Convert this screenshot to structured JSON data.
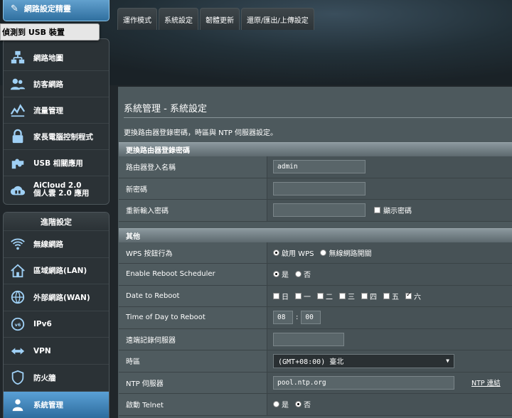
{
  "sidebar": {
    "quick_setup": "網路設定精靈",
    "usb_tip": "偵測到 USB 裝置",
    "general_items": [
      {
        "icon": "network-map-icon",
        "label": "網路地圖"
      },
      {
        "icon": "guest-network-icon",
        "label": "訪客網路"
      },
      {
        "icon": "traffic-manager-icon",
        "label": "流量管理"
      },
      {
        "icon": "parental-control-icon",
        "label": "家長電腦控制程式"
      },
      {
        "icon": "usb-application-icon",
        "label": "USB 相關應用"
      },
      {
        "icon": "aicloud-icon",
        "label": "AiCloud 2.0\n個人雲 2.0 應用"
      }
    ],
    "advanced_title": "進階設定",
    "advanced_items": [
      {
        "icon": "wireless-icon",
        "label": "無線網路"
      },
      {
        "icon": "lan-icon",
        "label": "區域網路(LAN)"
      },
      {
        "icon": "wan-icon",
        "label": "外部網路(WAN)"
      },
      {
        "icon": "ipv6-icon",
        "label": "IPv6"
      },
      {
        "icon": "vpn-icon",
        "label": "VPN"
      },
      {
        "icon": "firewall-icon",
        "label": "防火牆"
      },
      {
        "icon": "administration-icon",
        "label": "系統管理"
      }
    ]
  },
  "tabs": [
    "運作模式",
    "系統設定",
    "韌體更新",
    "還原/匯出/上傳設定"
  ],
  "page": {
    "title": "系統管理 - 系統設定",
    "description": "更換路由器登錄密碼，時區與 NTP 伺服器設定。"
  },
  "section1": {
    "header": "更換路由器登錄密碼",
    "login_name_label": "路由器登入名稱",
    "login_name_value": "admin",
    "new_password_label": "新密碼",
    "confirm_password_label": "重新輸入密碼",
    "show_password_label": "顯示密碼"
  },
  "section2": {
    "header": "其他",
    "wps_label": "WPS 按鈕行為",
    "wps_opt1": "啟用 WPS",
    "wps_opt2": "無線網路開關",
    "reboot_sched_label": "Enable Reboot Scheduler",
    "yes": "是",
    "no": "否",
    "date_reboot_label": "Date to Reboot",
    "days": [
      "日",
      "一",
      "二",
      "三",
      "四",
      "五",
      "六"
    ],
    "days_checked": [
      false,
      false,
      false,
      false,
      false,
      false,
      true
    ],
    "time_reboot_label": "Time of Day to Reboot",
    "hour": "08",
    "minute": "00",
    "remote_log_label": "遠端記錄伺服器",
    "timezone_label": "時區",
    "timezone_value": "(GMT+08:00) 臺北",
    "ntp_label": "NTP 伺服器",
    "ntp_value": "pool.ntp.org",
    "ntp_link": "NTP 連結",
    "telnet_label": "啟動 Telnet"
  }
}
